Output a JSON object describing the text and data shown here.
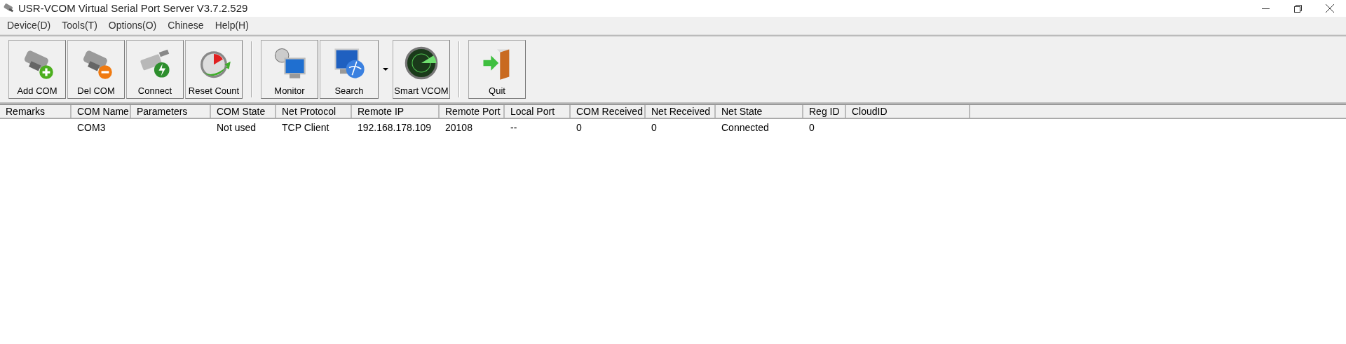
{
  "window": {
    "title": "USR-VCOM Virtual Serial Port Server V3.7.2.529"
  },
  "menu": [
    "Device(D)",
    "Tools(T)",
    "Options(O)",
    "Chinese",
    "Help(H)"
  ],
  "toolbar": [
    {
      "kind": "button",
      "label": "Add COM"
    },
    {
      "kind": "button",
      "label": "Del COM"
    },
    {
      "kind": "button",
      "label": "Connect"
    },
    {
      "kind": "button",
      "label": "Reset Count"
    },
    {
      "kind": "separator"
    },
    {
      "kind": "button",
      "label": "Monitor"
    },
    {
      "kind": "split",
      "label": "Search"
    },
    {
      "kind": "button",
      "label": "Smart VCOM"
    },
    {
      "kind": "separator"
    },
    {
      "kind": "button",
      "label": "Quit"
    }
  ],
  "table": {
    "columns": [
      "Remarks",
      "COM Name",
      "Parameters",
      "COM State",
      "Net Protocol",
      "Remote IP",
      "Remote Port",
      "Local Port",
      "COM Received",
      "Net Received",
      "Net State",
      "Reg ID",
      "CloudID"
    ],
    "rows": [
      [
        "",
        "COM3",
        "",
        "Not used",
        "TCP Client",
        "192.168.178.109",
        "20108",
        "--",
        "0",
        "0",
        "Connected",
        "0",
        ""
      ]
    ]
  }
}
